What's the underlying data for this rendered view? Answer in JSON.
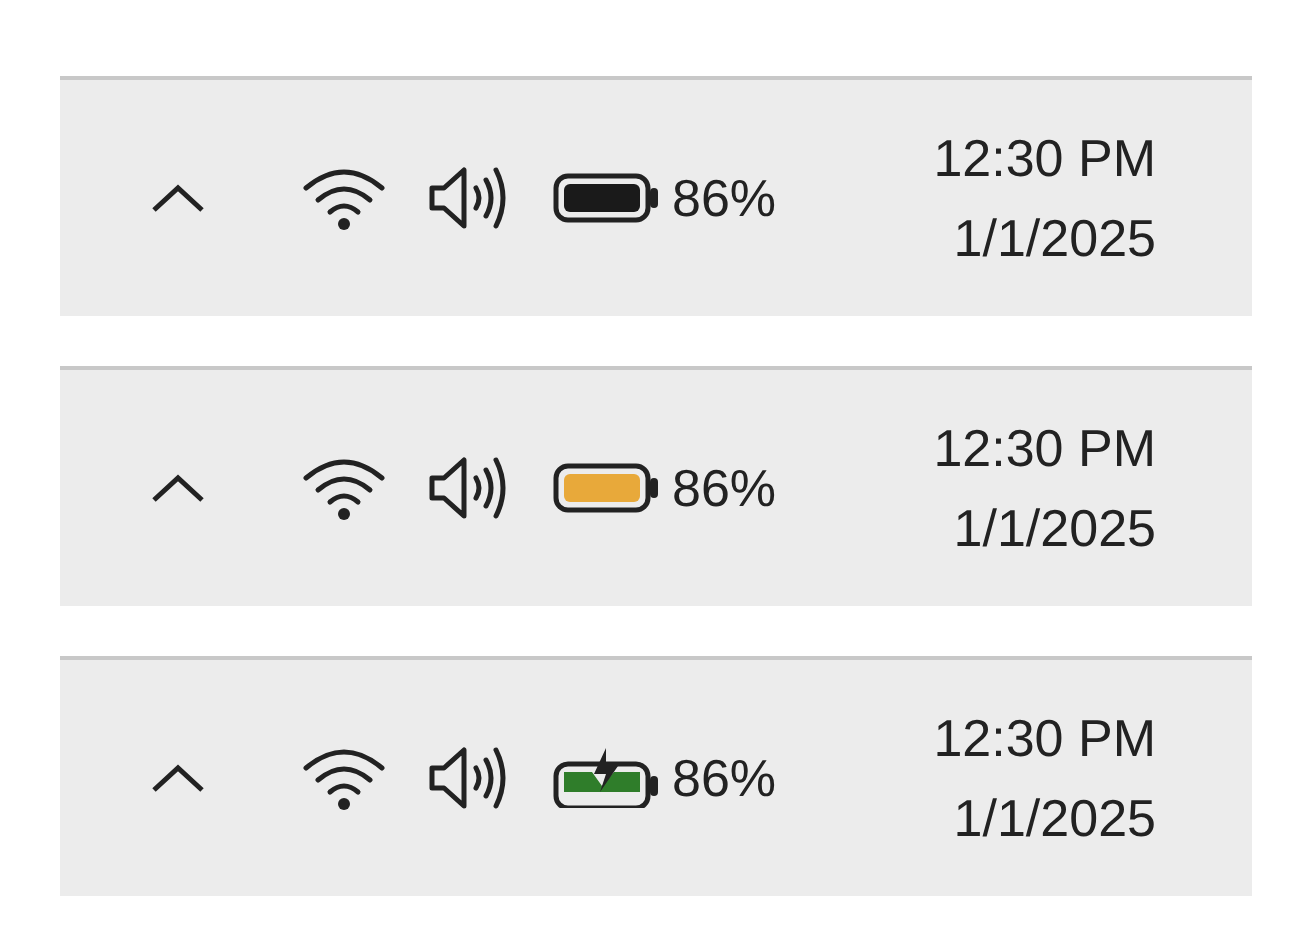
{
  "taskbars": [
    {
      "battery": {
        "color": "#1a1a1a",
        "charging": false,
        "percent": "86%"
      },
      "time": "12:30 PM",
      "date": "1/1/2025"
    },
    {
      "battery": {
        "color": "#e8a93a",
        "charging": false,
        "percent": "86%"
      },
      "time": "12:30 PM",
      "date": "1/1/2025"
    },
    {
      "battery": {
        "color": "#2f7d2a",
        "charging": true,
        "percent": "86%"
      },
      "time": "12:30 PM",
      "date": "1/1/2025"
    }
  ]
}
